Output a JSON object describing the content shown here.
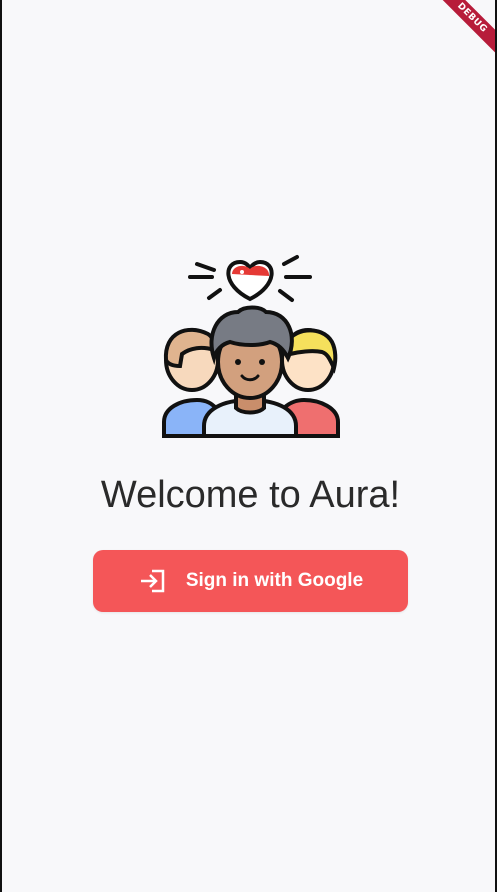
{
  "app": {
    "debug_banner": "DEBUG"
  },
  "welcome": {
    "title": "Welcome to Aura!"
  },
  "auth": {
    "signin_label": "Sign in with Google",
    "signin_icon": "login-icon"
  },
  "illustration": {
    "name": "community-people-icon",
    "accent_color": "#f45658"
  }
}
